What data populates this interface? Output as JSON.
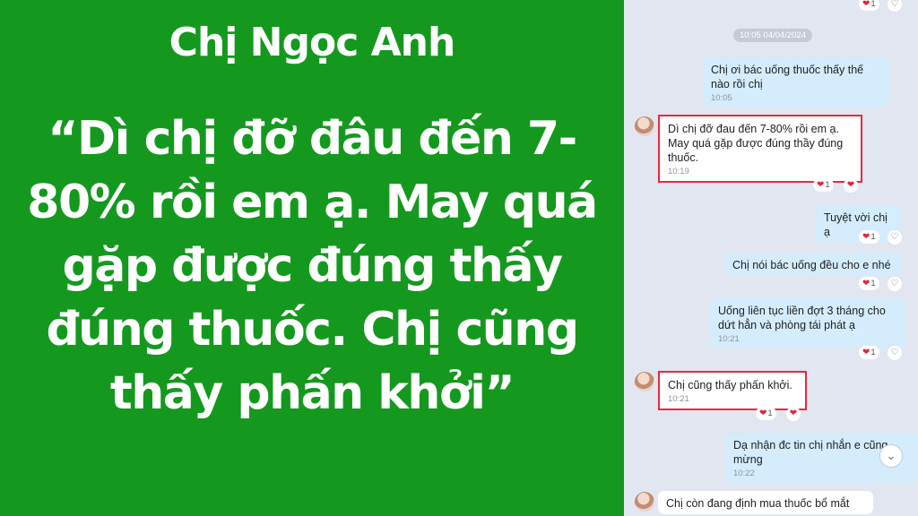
{
  "headline": {
    "name": "Chị Ngọc Anh",
    "quote": "“Dì chị đỡ đâu đến 7-80% rồi em ạ. May quá gặp được đúng thấy đúng thuốc. Chị cũng thấy phấn khởi”"
  },
  "chat": {
    "date_stamp": "10:05 04/04/2024",
    "messages": [
      {
        "text": "Chị ơi bác uống thuốc thấy thế nào rồi chị",
        "time": "10:05"
      },
      {
        "text": "Dì chị đỡ đau đến 7-80% rồi em ạ. May quá gặp được đúng thầy đúng thuốc.",
        "time": "10:19"
      },
      {
        "text": "Tuyệt vời chị ạ",
        "time": ""
      },
      {
        "text": "Chị nói bác uống đều cho e nhé",
        "time": ""
      },
      {
        "text": "Uống liên tục liền đợt 3 tháng cho dứt hẳn và phòng tái phát ạ",
        "time": "10:21"
      },
      {
        "text": "Chị cũng thấy phấn khởi.",
        "time": "10:21"
      },
      {
        "text": "Dạ nhận đc tin chị nhắn e cũng mừng",
        "time": "10:22"
      },
      {
        "text": "Chị còn đang định mua thuốc bổ mắt",
        "time": ""
      }
    ],
    "reaction_count": "1",
    "heart_icon": "heart-icon",
    "react_icon": "heart-outline-icon",
    "scroll_icon": "chevron-down-icon"
  },
  "colors": {
    "left_bg": "#14991e",
    "highlight_border": "#e8293f",
    "sent_bubble": "#d4ecfb",
    "chat_bg": "#e2e6f0"
  }
}
